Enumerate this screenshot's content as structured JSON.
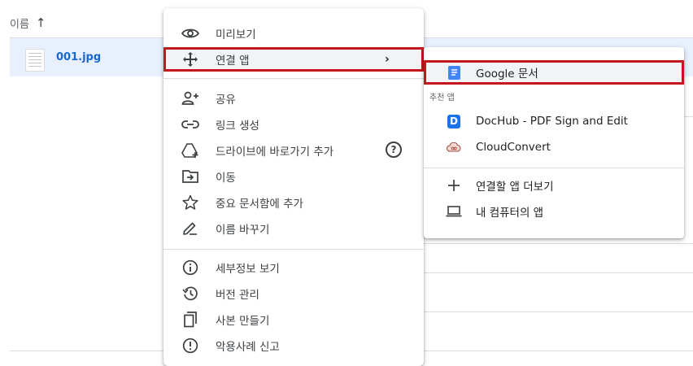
{
  "file_list": {
    "column_name": "이름",
    "sort_arrow": "↑",
    "file": {
      "name": "001.jpg"
    }
  },
  "context_menu": {
    "preview": "미리보기",
    "open_with": "연결 앱",
    "open_with_chevron": "›",
    "share": "공유",
    "get_link": "링크 생성",
    "add_shortcut": "드라이브에 바로가기 추가",
    "help_glyph": "?",
    "move": "이동",
    "add_starred": "중요 문서함에 추가",
    "rename": "이름 바꾸기",
    "details": "세부정보 보기",
    "versions": "버전 관리",
    "make_copy": "사본 만들기",
    "report_abuse": "악용사례 신고"
  },
  "submenu": {
    "google_docs": "Google 문서",
    "suggested_section": "추천 앱",
    "dochub": "DocHub - PDF Sign and Edit",
    "dochub_glyph": "D",
    "cloudconvert": "CloudConvert",
    "more_apps": "연결할 앱 더보기",
    "computer_apps": "내 컴퓨터의 앱"
  },
  "colors": {
    "highlight_border": "#c5161f",
    "selected_row": "#e8f0fe",
    "link_blue": "#1967d2",
    "docs_blue": "#4285f4",
    "dochub_blue": "#1a73e8"
  }
}
